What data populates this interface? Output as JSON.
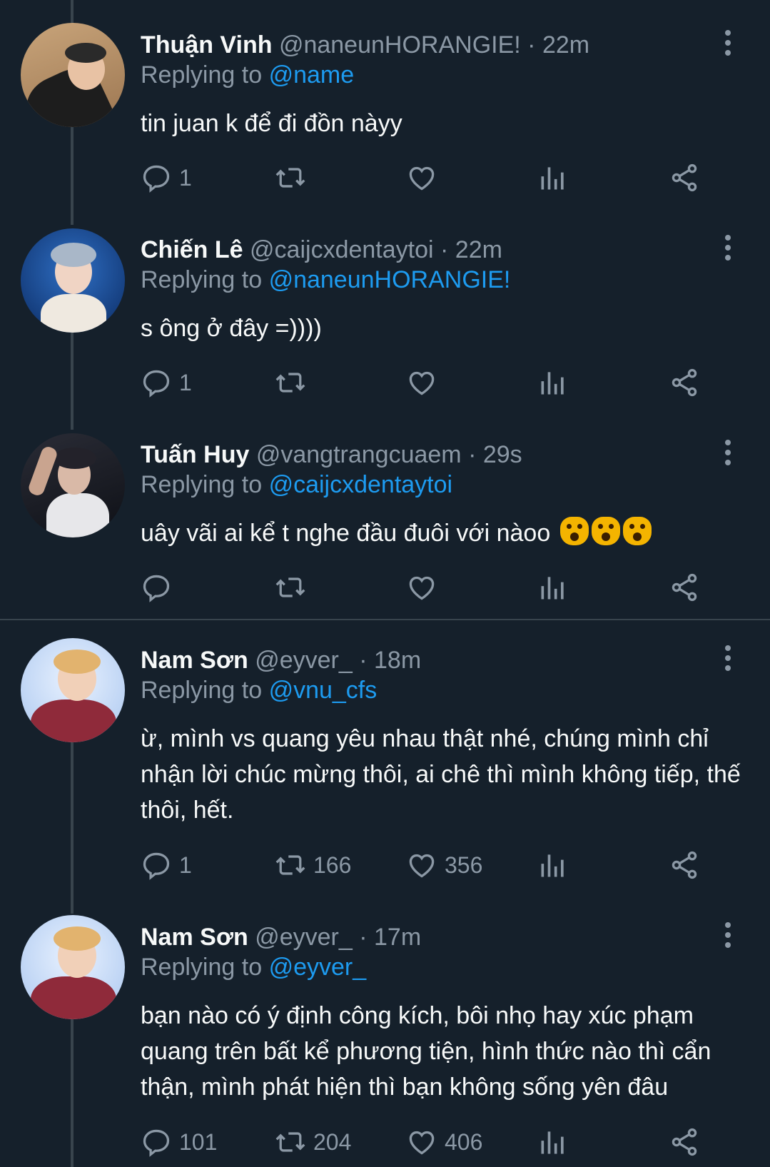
{
  "tweets": [
    {
      "name": "Thuận Vinh",
      "handle": "@naneunHORANGIE!",
      "time": "· 22m",
      "replying_label": "Replying to",
      "replying_to": "@name",
      "text": "tin juan k để đi đồn nàyy",
      "reply_count": "1",
      "retweet_count": "",
      "like_count": ""
    },
    {
      "name": "Chiến Lê",
      "handle": "@caijcxdentaytoi",
      "time": "· 22m",
      "replying_label": "Replying to",
      "replying_to": "@naneunHORANGIE!",
      "text": "s ông ở đây =))))",
      "reply_count": "1",
      "retweet_count": "",
      "like_count": ""
    },
    {
      "name": "Tuấn Huy",
      "handle": "@vangtrangcuaem",
      "time": "· 29s",
      "replying_label": "Replying to",
      "replying_to": "@caijcxdentaytoi",
      "text": "uây vãi ai kể t nghe đầu đuôi với nàoo",
      "emoji": "scream-cat-emoji",
      "reply_count": "",
      "retweet_count": "",
      "like_count": ""
    },
    {
      "name": "Nam Sơn",
      "handle": "@eyver_",
      "time": "· 18m",
      "replying_label": "Replying to",
      "replying_to": "@vnu_cfs",
      "text": "ừ, mình vs quang yêu nhau thật nhé, chúng mình chỉ nhận lời chúc mừng thôi, ai chê thì mình không tiếp, thế thôi, hết.",
      "reply_count": "1",
      "retweet_count": "166",
      "like_count": "356"
    },
    {
      "name": "Nam Sơn",
      "handle": "@eyver_",
      "time": "· 17m",
      "replying_label": "Replying to",
      "replying_to": "@eyver_",
      "text": "bạn nào có ý định công kích, bôi nhọ hay xúc phạm quang trên bất kể phương tiện, hình thức nào thì cẩn thận, mình phát hiện thì bạn không sống yên đâu",
      "reply_count": "101",
      "retweet_count": "204",
      "like_count": "406"
    }
  ]
}
